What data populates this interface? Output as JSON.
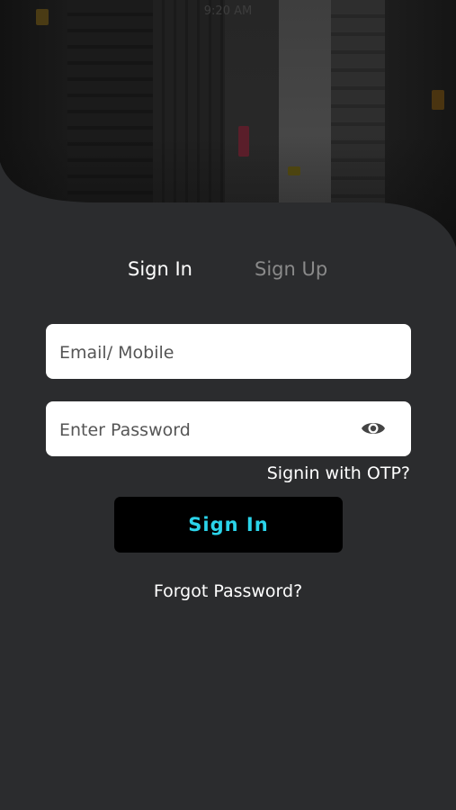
{
  "status_bar": {
    "time": "9:20 AM"
  },
  "tabs": [
    {
      "label": "Sign In",
      "active": true
    },
    {
      "label": "Sign Up",
      "active": false
    }
  ],
  "form": {
    "email_placeholder": "Email/ Mobile",
    "email_value": "",
    "password_placeholder": "Enter Password",
    "password_value": "",
    "password_toggle_icon": "eye-icon",
    "otp_link": "Signin with OTP?",
    "submit_label": "Sign In",
    "forgot_link": "Forgot Password?"
  },
  "colors": {
    "background": "#2b2c2e",
    "accent_text": "#2bd4ea",
    "button_bg": "#000000",
    "inactive_tab": "#8a8a8a"
  }
}
